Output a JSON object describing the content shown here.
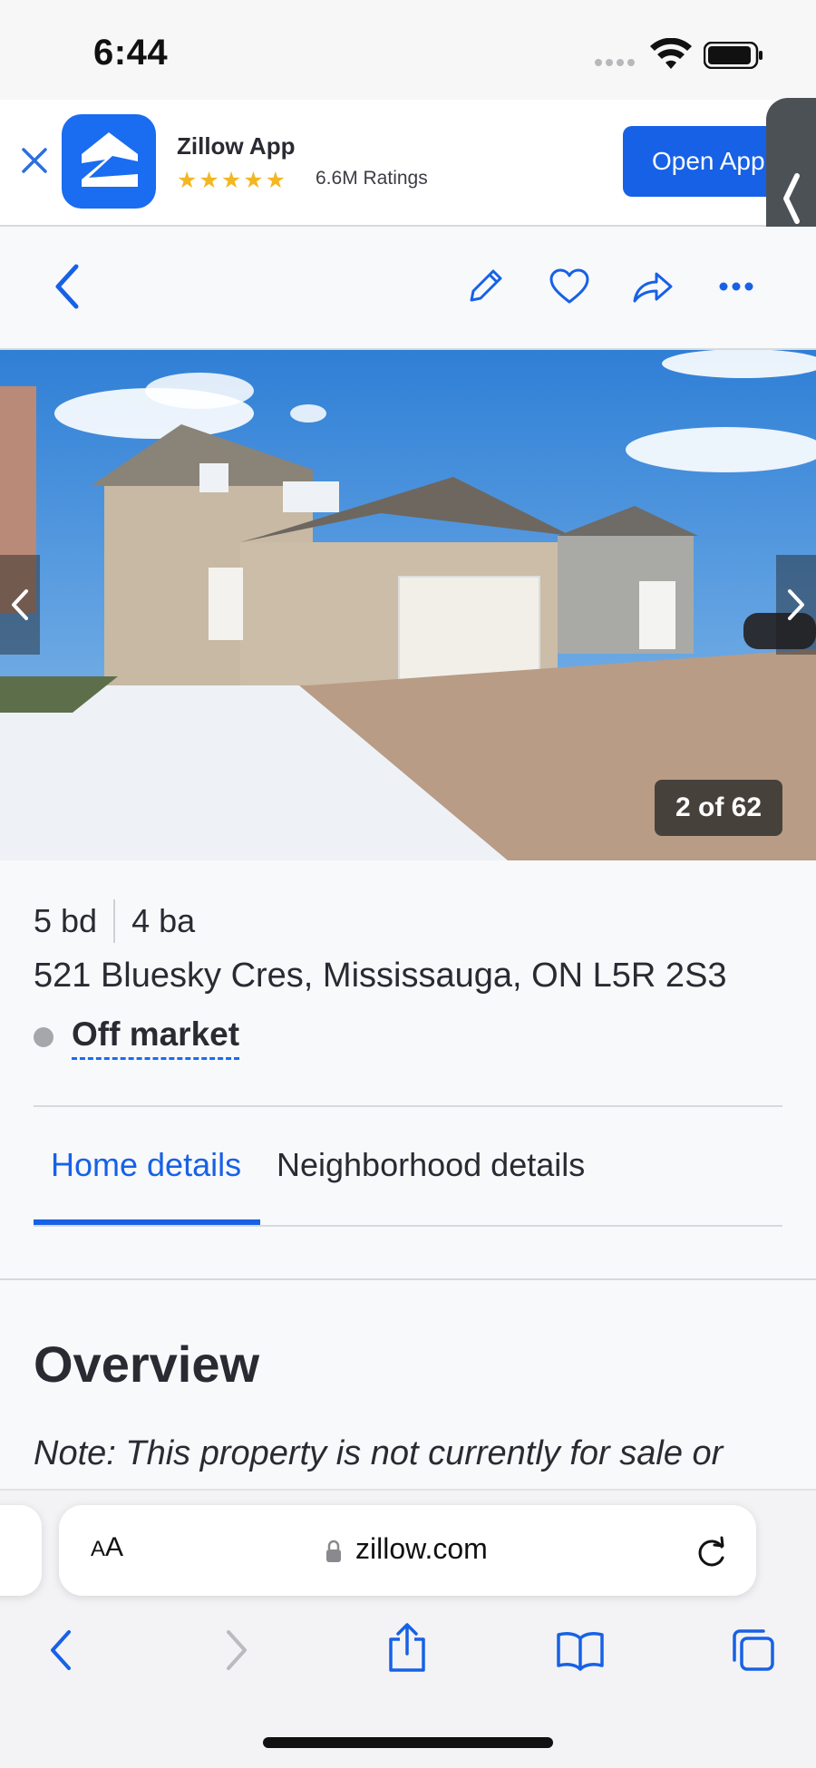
{
  "status_bar": {
    "time": "6:44"
  },
  "app_banner": {
    "app_name": "Zillow App",
    "stars": "★★★★★",
    "ratings": "6.6M Ratings",
    "open_button": "Open App",
    "brand_color": "#1a6cf0"
  },
  "toolbar": {
    "back_icon": "chevron-left-icon",
    "edit_icon": "pencil-icon",
    "save_icon": "heart-icon",
    "share_icon": "share-arrow-icon",
    "more_icon": "more-dots-icon"
  },
  "photo": {
    "counter": "2 of 62",
    "current_index": 2,
    "total": 62
  },
  "listing": {
    "beds": "5 bd",
    "baths": "4 ba",
    "address": "521 Bluesky Cres, Mississauga, ON L5R 2S3",
    "status": "Off market",
    "status_color": "#a6a7ab"
  },
  "tabs": [
    {
      "label": "Home details",
      "active": true
    },
    {
      "label": "Neighborhood details",
      "active": false
    }
  ],
  "overview": {
    "heading": "Overview",
    "note": "Note: This property is not currently for sale or"
  },
  "browser": {
    "text_size_label_small": "A",
    "text_size_label_large": "A",
    "url": "zillow.com",
    "accent_color": "#1761e6"
  }
}
